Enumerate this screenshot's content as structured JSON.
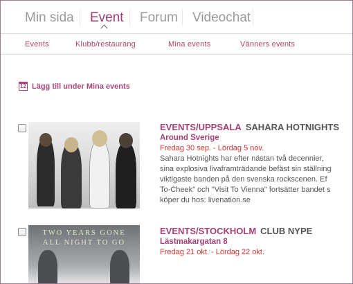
{
  "topnav": {
    "tabs": [
      {
        "label": "Min sida",
        "active": false
      },
      {
        "label": "Event",
        "active": true
      },
      {
        "label": "Forum",
        "active": false
      },
      {
        "label": "Videochat",
        "active": false
      }
    ]
  },
  "subnav": {
    "items": [
      "Events",
      "Klubb/restaurang",
      "Mina events",
      "Vänners events"
    ]
  },
  "add_link": {
    "icon": "calendar-icon",
    "label": "Lägg till under Mina events"
  },
  "events": [
    {
      "category": "EVENTS/UPPSALA",
      "name": "SAHARA HOTNIGHTS",
      "subtitle": "Around Sverige",
      "date": "Fredag 30 sep. - Lördag 5 nov.",
      "description": [
        "Sahara Hotnights har efter nästan två decennier,",
        "sina explosiva livaframträdande befäst sin ställning",
        "viktigaste banden på den svenska rockscenen. Ef",
        "To-Cheek\" och \"Visit To Vienna\" fortsätter bandet s",
        "köper du hos: livenation.se"
      ]
    },
    {
      "category": "EVENTS/STOCKHOLM",
      "name": "CLUB NYPE",
      "subtitle": "Lästmakargatan 8",
      "date": "Fredag 21 okt. - Lördag 22 okt.",
      "image_text": [
        "TWO YEARS GONE",
        "ALL NIGHT TO GO"
      ]
    }
  ],
  "colors": {
    "accent": "#a33f72",
    "date": "#d2352e",
    "frame": "#9b7a91"
  }
}
